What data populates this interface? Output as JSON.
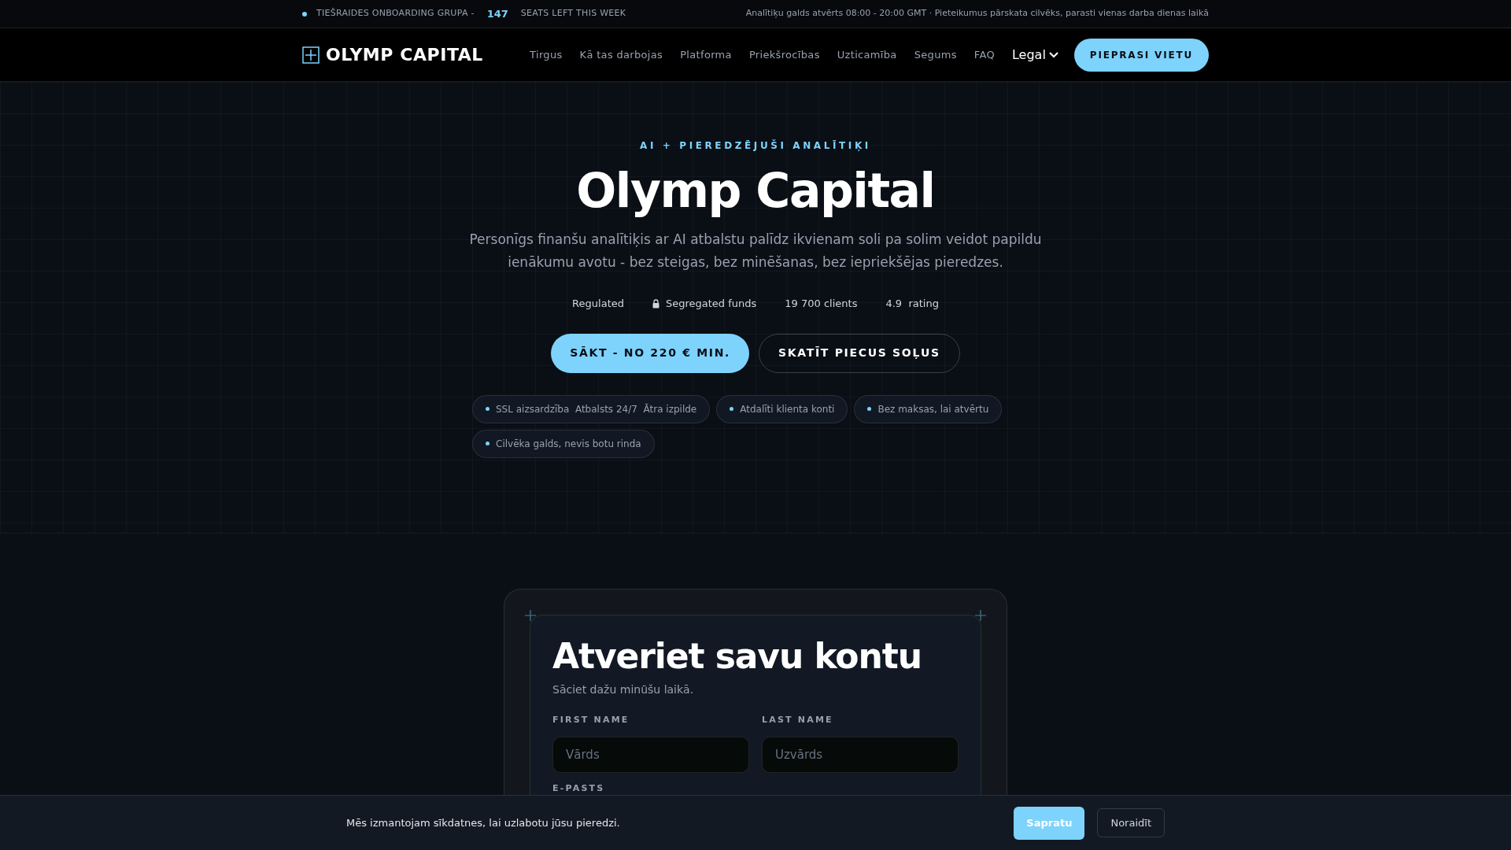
{
  "announcement": {
    "label": "TIEŠRAIDES ONBOARDING GRUPA -",
    "count": "147",
    "suffix": "SEATS LEFT THIS WEEK",
    "info": "Analītiķu galds atvērts 08:00 - 20:00 GMT · Pieteikumus pārskata cilvēks, parasti vienas darba dienas laikā"
  },
  "nav": {
    "logo": "OLYMP CAPITAL",
    "links": [
      {
        "label": "Tirgus",
        "kind": "link"
      },
      {
        "label": "Kā tas darbojas",
        "kind": "link"
      },
      {
        "label": "Platforma",
        "kind": "link"
      },
      {
        "label": "Priekšrocības",
        "kind": "link"
      },
      {
        "label": "Uzticamība",
        "kind": "link"
      },
      {
        "label": "Segums",
        "kind": "link"
      },
      {
        "label": "FAQ",
        "kind": "link"
      },
      {
        "label": "Legal",
        "kind": "dropdown"
      }
    ],
    "cta": "PIEPRASI VIETU"
  },
  "hero": {
    "eyebrow": "AI + PIEREDZĒJUŠI ANALĪTIĶI",
    "title": "Olymp Capital",
    "subtitle": "Personīgs finanšu analītiķis ar AI atbalstu palīdz ikvienam soli pa solim veidot papildu ienākumu avotu - bez steigas, bez minēšanas, bez iepriekšējas pieredzes.",
    "stats": [
      {
        "label": "Regulated",
        "kind": "plain"
      },
      {
        "label": "Segregated funds",
        "kind": "lock"
      },
      {
        "label": "19 700 clients",
        "kind": "plain"
      },
      {
        "label": "4.9  rating",
        "kind": "plain"
      }
    ],
    "primary_button": "SĀKT - NO 220 € MIN.",
    "secondary_button": "SKATĪT PIECUS SOĻUS",
    "chips": [
      "SSL aizsardzība  Atbalsts 24/7  Ātra izpilde",
      "Atdalīti klienta konti",
      "Bez maksas, lai atvērtu",
      "Cilvēka galds, nevis botu rinda"
    ]
  },
  "form": {
    "title": "Atveriet savu kontu",
    "subtitle": "Sāciet dažu minūšu laikā.",
    "fields": [
      {
        "label": "FIRST NAME",
        "placeholder": "Vārds"
      },
      {
        "label": "LAST NAME",
        "placeholder": "Uzvārds"
      }
    ],
    "next_label": "E-PASTS"
  },
  "cookie": {
    "text": "Mēs izmantojam sīkdatnes, lai uzlabotu jūsu pieredzi.",
    "accept": "Sapratu",
    "decline": "Noraidīt"
  }
}
